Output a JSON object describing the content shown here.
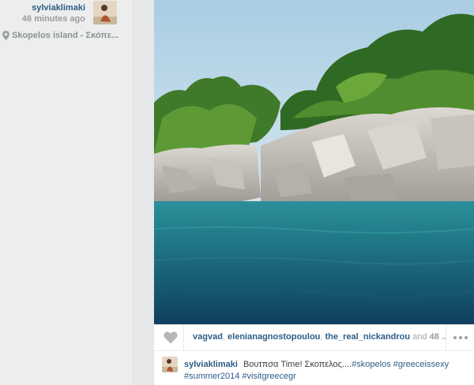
{
  "post": {
    "username": "sylviaklimaki",
    "timestamp": "46 minutes ago",
    "location": "Skopelos island - Σκόπε..."
  },
  "likes": {
    "users": [
      "vagvad",
      "elenianagnostopoulou",
      "the_real_nickandrou"
    ],
    "and_text": "and",
    "more_count": "48 ..."
  },
  "caption": {
    "username": "sylviaklimaki",
    "text_intro": "Βουτπσα Time! Σκοπελος....",
    "hashtags": [
      "#skopelos",
      "#greeceissexy",
      "#summer2014",
      "#visitgreecegr"
    ]
  },
  "icons": {
    "location": "map-pin-icon",
    "like": "heart-icon",
    "more": "ellipsis-icon"
  }
}
